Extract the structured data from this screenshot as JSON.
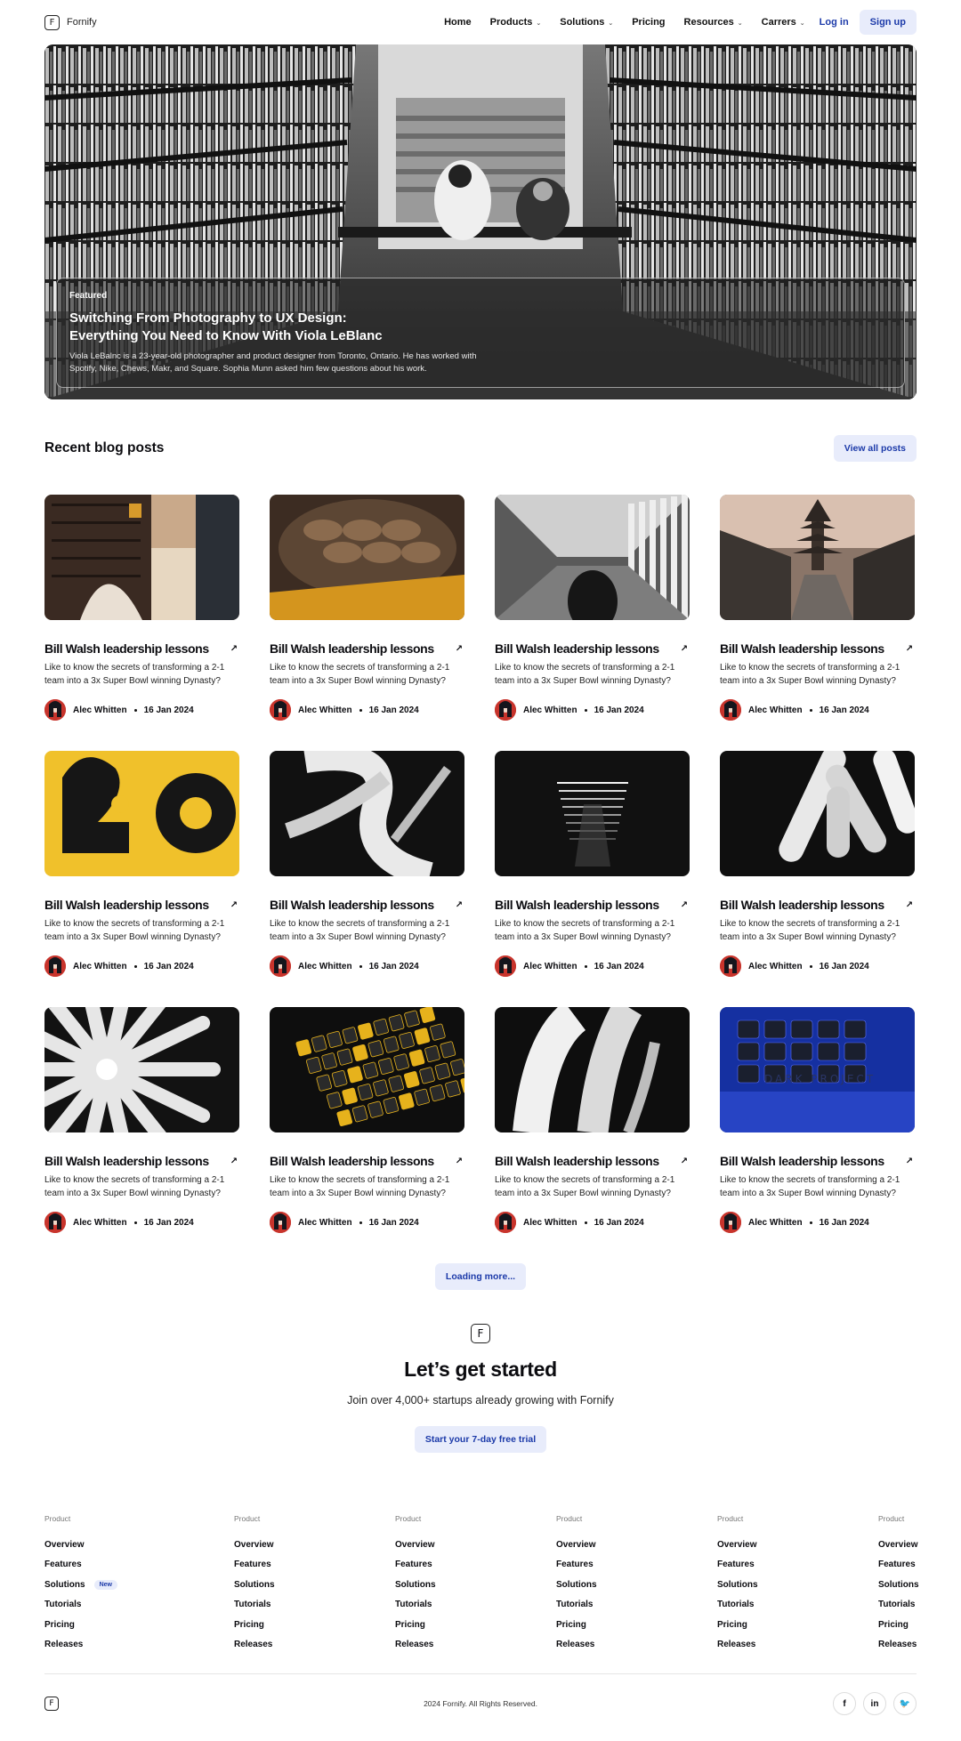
{
  "header": {
    "logo_letter": "F",
    "brand": "Fornify",
    "nav": [
      {
        "label": "Home",
        "dropdown": false
      },
      {
        "label": "Products",
        "dropdown": true
      },
      {
        "label": "Solutions",
        "dropdown": true
      },
      {
        "label": "Pricing",
        "dropdown": false
      },
      {
        "label": "Resources",
        "dropdown": true
      },
      {
        "label": "Carrers",
        "dropdown": true
      }
    ],
    "login": "Log in",
    "signup": "Sign up"
  },
  "hero": {
    "tag": "Featured",
    "title": "Switching  From Photography to UX Design:\nEverything You Need to Know With Viola LeBlanc",
    "description": "Viola LeBalnc is a 23-year-old photographer and product designer from Toronto, Ontario. He has worked with Spotify, Nike, Chews, Makr, and Square. Sophia Munn asked him few questions about his work."
  },
  "blog": {
    "section_title": "Recent blog posts",
    "view_all": "View all posts",
    "posts": [
      {
        "title": "Bill Walsh leadership lessons",
        "desc": "Like to know the secrets of transforming a 2-1 team into a 3x Super Bowl winning Dynasty?",
        "author": "Alec Whitten",
        "date": "16 Jan 2024",
        "image": "building-street"
      },
      {
        "title": "Bill Walsh leadership lessons",
        "desc": "Like to know the secrets of transforming a 2-1 team into a 3x Super Bowl winning Dynasty?",
        "author": "Alec Whitten",
        "date": "16 Jan 2024",
        "image": "desert-rocks"
      },
      {
        "title": "Bill Walsh leadership lessons",
        "desc": "Like to know the secrets of transforming a 2-1 team into a 3x Super Bowl winning Dynasty?",
        "author": "Alec Whitten",
        "date": "16 Jan 2024",
        "image": "colonnade"
      },
      {
        "title": "Bill Walsh leadership lessons",
        "desc": "Like to know the secrets of transforming a 2-1 team into a 3x Super Bowl winning Dynasty?",
        "author": "Alec Whitten",
        "date": "16 Jan 2024",
        "image": "pagoda-street"
      },
      {
        "title": "Bill Walsh leadership lessons",
        "desc": "Like to know the secrets of transforming a 2-1 team into a 3x Super Bowl winning Dynasty?",
        "author": "Alec Whitten",
        "date": "16 Jan 2024",
        "image": "yellow-graphic"
      },
      {
        "title": "Bill Walsh leadership lessons",
        "desc": "Like to know the secrets of transforming a 2-1 team into a 3x Super Bowl winning Dynasty?",
        "author": "Alec Whitten",
        "date": "16 Jan 2024",
        "image": "brush-strokes"
      },
      {
        "title": "Bill Walsh leadership lessons",
        "desc": "Like to know the secrets of transforming a 2-1 team into a 3x Super Bowl winning Dynasty?",
        "author": "Alec Whitten",
        "date": "16 Jan 2024",
        "image": "light-tunnel"
      },
      {
        "title": "Bill Walsh leadership lessons",
        "desc": "Like to know the secrets of transforming a 2-1 team into a 3x Super Bowl winning Dynasty?",
        "author": "Alec Whitten",
        "date": "16 Jan 2024",
        "image": "white-capsules"
      },
      {
        "title": "Bill Walsh leadership lessons",
        "desc": "Like to know the secrets of transforming a 2-1 team into a 3x Super Bowl winning Dynasty?",
        "author": "Alec Whitten",
        "date": "16 Jan 2024",
        "image": "radial-shapes"
      },
      {
        "title": "Bill Walsh leadership lessons",
        "desc": "Like to know the secrets of transforming a 2-1 team into a 3x Super Bowl winning Dynasty?",
        "author": "Alec Whitten",
        "date": "16 Jan 2024",
        "image": "yellow-keyboard"
      },
      {
        "title": "Bill Walsh leadership lessons",
        "desc": "Like to know the secrets of transforming a 2-1 team into a 3x Super Bowl winning Dynasty?",
        "author": "Alec Whitten",
        "date": "16 Jan 2024",
        "image": "white-paint"
      },
      {
        "title": "Bill Walsh leadership lessons",
        "desc": "Like to know the secrets of transforming a 2-1 team into a 3x Super Bowl winning Dynasty?",
        "author": "Alec Whitten",
        "date": "16 Jan 2024",
        "image": "rgb-keyboard"
      }
    ],
    "loading": "Loading more...",
    "rgb_keyboard_text": "DARK PROJECT"
  },
  "cta": {
    "logo_letter": "F",
    "title": "Let’s get started",
    "subtitle": "Join over 4,000+ startups already growing with Fornify",
    "button": "Start your 7-day free trial"
  },
  "footer": {
    "columns": [
      {
        "heading": "Product",
        "links": [
          "Overview",
          "Features",
          "Solutions",
          "Tutorials",
          "Pricing",
          "Releases"
        ],
        "badge_index": 2,
        "badge": "New"
      },
      {
        "heading": "Product",
        "links": [
          "Overview",
          "Features",
          "Solutions",
          "Tutorials",
          "Pricing",
          "Releases"
        ]
      },
      {
        "heading": "Product",
        "links": [
          "Overview",
          "Features",
          "Solutions",
          "Tutorials",
          "Pricing",
          "Releases"
        ]
      },
      {
        "heading": "Product",
        "links": [
          "Overview",
          "Features",
          "Solutions",
          "Tutorials",
          "Pricing",
          "Releases"
        ]
      },
      {
        "heading": "Product",
        "links": [
          "Overview",
          "Features",
          "Solutions",
          "Tutorials",
          "Pricing",
          "Releases"
        ]
      },
      {
        "heading": "Product",
        "links": [
          "Overview",
          "Features",
          "Solutions",
          "Tutorials",
          "Pricing",
          "Releases"
        ]
      }
    ],
    "logo_letter": "F",
    "copyright": "2024 Fornify. All Rights Reserved.",
    "socials": [
      {
        "icon": "facebook-icon",
        "glyph": "f"
      },
      {
        "icon": "linkedin-icon",
        "glyph": "in"
      },
      {
        "icon": "twitter-icon",
        "glyph": "🐦"
      }
    ]
  },
  "colors": {
    "accent": "#1c3aa9",
    "accent_soft": "#e8ecfb",
    "text": "#0b0b0f"
  }
}
